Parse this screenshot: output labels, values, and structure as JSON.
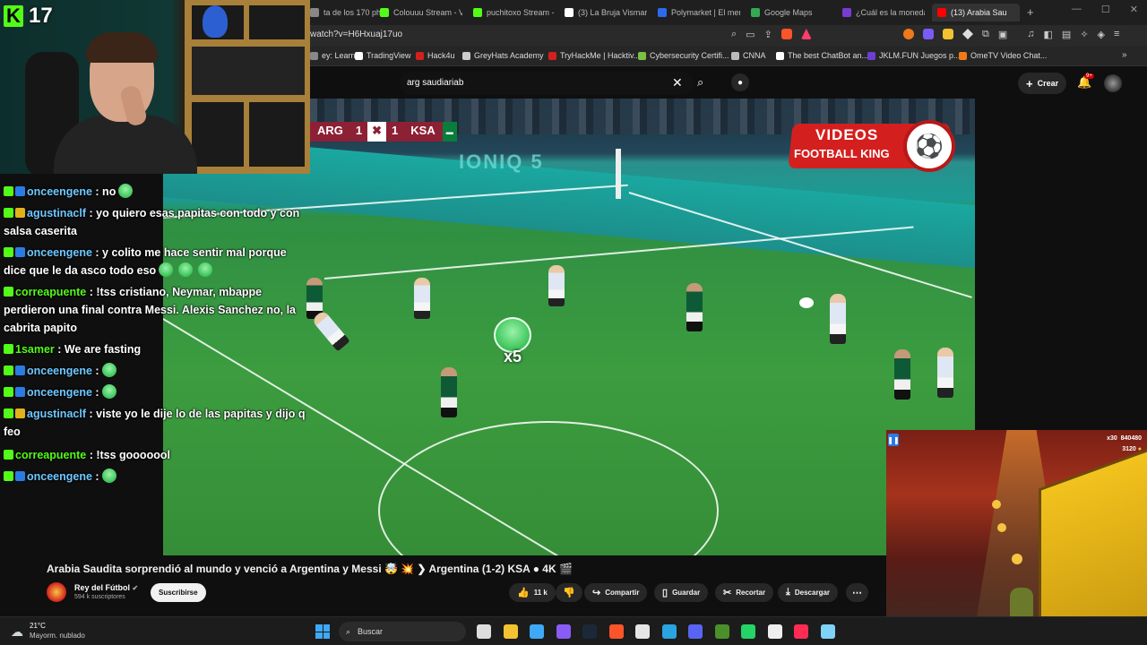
{
  "browser": {
    "tabs": [
      {
        "label": "ta de los 170 ph",
        "color": "#888888"
      },
      {
        "label": "Colouuu Stream - V",
        "color": "#53fc18"
      },
      {
        "label": "puchitoxo Stream -",
        "color": "#53fc18"
      },
      {
        "label": "(3) La Bruja Vismara",
        "color": "#ffffff"
      },
      {
        "label": "Polymarket | El mer",
        "color": "#2c6bed"
      },
      {
        "label": "Google Maps",
        "color": "#34a853"
      },
      {
        "label": "¿Cuál es la moneda",
        "color": "#7a3bd1"
      },
      {
        "label": "(13) Arabia Sau",
        "color": "#ff0000"
      }
    ],
    "new_tab_icon": "plus-icon",
    "url": "watch?v=H6Hxuaj17uo",
    "bookmarks": [
      {
        "label": "ey: Learn...",
        "color": "#888888"
      },
      {
        "label": "TradingView",
        "color": "#ffffff"
      },
      {
        "label": "Hack4u",
        "color": "#d41f1f"
      },
      {
        "label": "GreyHats Academy",
        "color": "#cccccc"
      },
      {
        "label": "TryHackMe | Hacktiv...",
        "color": "#d41f1f"
      },
      {
        "label": "Cybersecurity Certifi...",
        "color": "#7ac142"
      },
      {
        "label": "CNNA",
        "color": "#bbbbbb"
      },
      {
        "label": "The best ChatBot an...",
        "color": "#ffffff"
      },
      {
        "label": "JKLM.FUN Juegos p...",
        "color": "#6b3fd1"
      },
      {
        "label": "OmeTV Video Chat...",
        "color": "#f07a1a"
      }
    ]
  },
  "youtube": {
    "search_value": "arg saudiariab",
    "create_label": "Crear",
    "notif_count": "9+",
    "video": {
      "scorebug": {
        "home": "ARG",
        "home_score": "1",
        "away_score": "1",
        "away": "KSA"
      },
      "watermark_line1": "VIDEOS",
      "watermark_line2": "FOOTBALL KING",
      "ad_text": "IONIQ 5",
      "emote_multiplier": "x5"
    },
    "title": "Arabia Saudita sorprendió al mundo y venció a Argentina y Messi 🤯 💥 ❯ Argentina (1-2) KSA ● 4K 🎬",
    "channel": {
      "name": "Rey del Fútbol",
      "subscribers": "594 k suscriptores",
      "subscribe_label": "Suscribirse"
    },
    "actions": {
      "likes": "11 k",
      "share": "Compartir",
      "save": "Guardar",
      "clip": "Recortar",
      "download": "Descargar"
    }
  },
  "stream": {
    "viewer_count": "17",
    "chat": [
      {
        "badges": [
          "kick",
          "sub"
        ],
        "user": "onceengene",
        "text": ": no",
        "emotes": 1
      },
      {
        "badges": [
          "kick",
          "og"
        ],
        "user": "agustinaclf",
        "text": ": yo quiero esas papitas con todo y con salsa caserita",
        "emotes": 0
      },
      {
        "badges": [
          "kick",
          "sub"
        ],
        "user": "onceengene",
        "text": ": y colito me hace sentir mal porque dice que le da asco todo eso",
        "emotes": 3
      },
      {
        "badges": [
          "kick"
        ],
        "user": "correapuente",
        "text": ": !tss cristiano, Neymar, mbappe perdieron una final contra Messi. Alexis Sanchez no, la cabrita papito",
        "emotes": 0
      },
      {
        "badges": [
          "kick"
        ],
        "user": "1samer",
        "text": ": We are fasting",
        "emotes": 0
      },
      {
        "badges": [
          "kick",
          "sub"
        ],
        "user": "onceengene",
        "text": ":",
        "emotes": 1
      },
      {
        "badges": [
          "kick",
          "sub"
        ],
        "user": "onceengene",
        "text": ":",
        "emotes": 1
      },
      {
        "badges": [
          "kick",
          "og"
        ],
        "user": "agustinaclf",
        "text": ": viste yo le dije lo de las papitas y dijo q feo",
        "emotes": 0
      },
      {
        "badges": [
          "kick"
        ],
        "user": "correapuente",
        "text": ": !tss gooooool",
        "emotes": 0
      },
      {
        "badges": [
          "kick",
          "sub"
        ],
        "user": "onceengene",
        "text": ":",
        "emotes": 1
      }
    ],
    "game_hud": {
      "multiplier": "x30",
      "score": "840480",
      "coins": "3120"
    }
  },
  "taskbar": {
    "temperature": "21°C",
    "weather": "Mayorm. nublado",
    "search_placeholder": "Buscar",
    "apps": [
      {
        "name": "task-view-icon",
        "color": "#dddddd"
      },
      {
        "name": "explorer-icon",
        "color": "#f2c230"
      },
      {
        "name": "visual-studio-icon",
        "color": "#3fa9f5"
      },
      {
        "name": "obsidian-icon",
        "color": "#8a5cf5"
      },
      {
        "name": "steam-icon",
        "color": "#1b2838"
      },
      {
        "name": "brave-icon",
        "color": "#fb542b"
      },
      {
        "name": "chrome-icon",
        "color": "#e5e5e5"
      },
      {
        "name": "telegram-icon",
        "color": "#2aa3e0"
      },
      {
        "name": "discord-icon",
        "color": "#5865f2"
      },
      {
        "name": "minecraft-icon",
        "color": "#4a8f2b"
      },
      {
        "name": "whatsapp-icon",
        "color": "#25d366"
      },
      {
        "name": "xbox-icon",
        "color": "#eeeeee"
      },
      {
        "name": "tiktok-icon",
        "color": "#fe2c55"
      },
      {
        "name": "notepad-icon",
        "color": "#7fd3f7"
      }
    ]
  }
}
